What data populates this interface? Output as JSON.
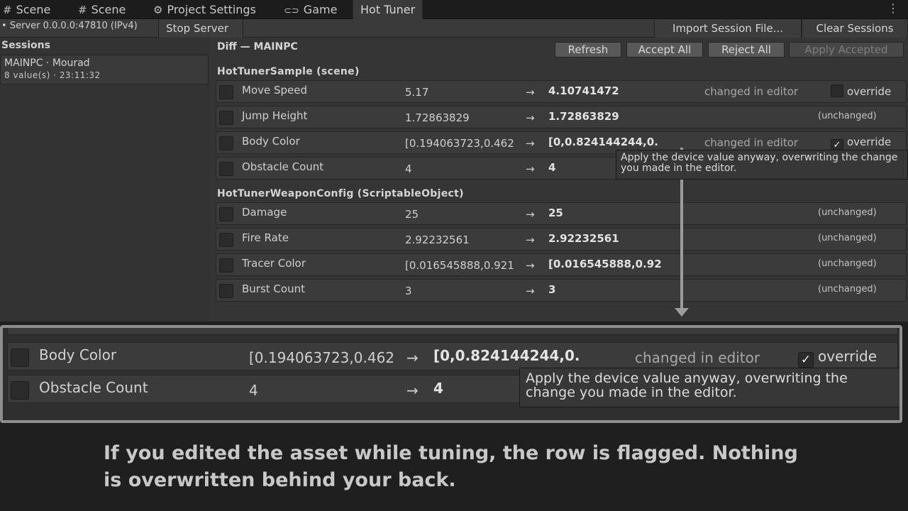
{
  "tabs": [
    {
      "icon": "#",
      "label": "Scene"
    },
    {
      "icon": "#",
      "label": "Scene"
    },
    {
      "icon": "⚙",
      "label": "Project Settings"
    },
    {
      "icon": "🎮",
      "label": "Game"
    },
    {
      "icon": "",
      "label": "Hot Tuner"
    }
  ],
  "toolbar": {
    "server_status": "Server 0.0.0.0:47810 (IPv4)",
    "stop_server": "Stop Server",
    "import_session": "Import Session File...",
    "clear_sessions": "Clear Sessions"
  },
  "sessions": {
    "heading": "Sessions",
    "items": [
      {
        "name": "MAINPC · Mourad",
        "meta": "8 value(s) · 23:11:32"
      }
    ]
  },
  "diff": {
    "title": "Diff — MAINPC",
    "buttons": {
      "refresh": "Refresh",
      "accept_all": "Accept All",
      "reject_all": "Reject All",
      "apply_accepted": "Apply Accepted"
    },
    "groups": [
      {
        "title": "HotTunerSample  (scene)",
        "rows": [
          {
            "name": "Move Speed",
            "old": "5.17",
            "new": "4.10741472",
            "state": "changed in editor",
            "override_label": "override",
            "override_checked": false
          },
          {
            "name": "Jump Height",
            "old": "1.72863829",
            "new": "1.72863829",
            "unchanged": "(unchanged)"
          },
          {
            "name": "Body Color",
            "old": "[0.194063723,0.462",
            "new": "[0,0.824144244,0.",
            "state": "changed in editor",
            "override_label": "override",
            "override_checked": true
          },
          {
            "name": "Obstacle Count",
            "old": "4",
            "new": "4"
          }
        ]
      },
      {
        "title": "HotTunerWeaponConfig  (ScriptableObject)",
        "rows": [
          {
            "name": "Damage",
            "old": "25",
            "new": "25",
            "unchanged": "(unchanged)"
          },
          {
            "name": "Fire Rate",
            "old": "2.92232561",
            "new": "2.92232561",
            "unchanged": "(unchanged)"
          },
          {
            "name": "Tracer Color",
            "old": "[0.016545888,0.921",
            "new": "[0.016545888,0.92",
            "unchanged": "(unchanged)"
          },
          {
            "name": "Burst Count",
            "old": "3",
            "new": "3",
            "unchanged": "(unchanged)"
          }
        ]
      }
    ],
    "arrow": "→",
    "check": "✓",
    "tooltip": "Apply the device value anyway, overwriting the change you made in the editor."
  },
  "zoom": {
    "rows": [
      {
        "name": "Body Color",
        "old": "[0.194063723,0.462",
        "new": "[0,0.824144244,0.",
        "state": "changed in editor",
        "override_label": "override"
      },
      {
        "name": "Obstacle Count",
        "old": "4",
        "new": "4"
      }
    ],
    "tooltip": "Apply the device value anyway, overwriting the change you made in the editor."
  },
  "caption": "If you edited the asset while tuning, the row is flagged. Nothing is overwritten behind your back."
}
